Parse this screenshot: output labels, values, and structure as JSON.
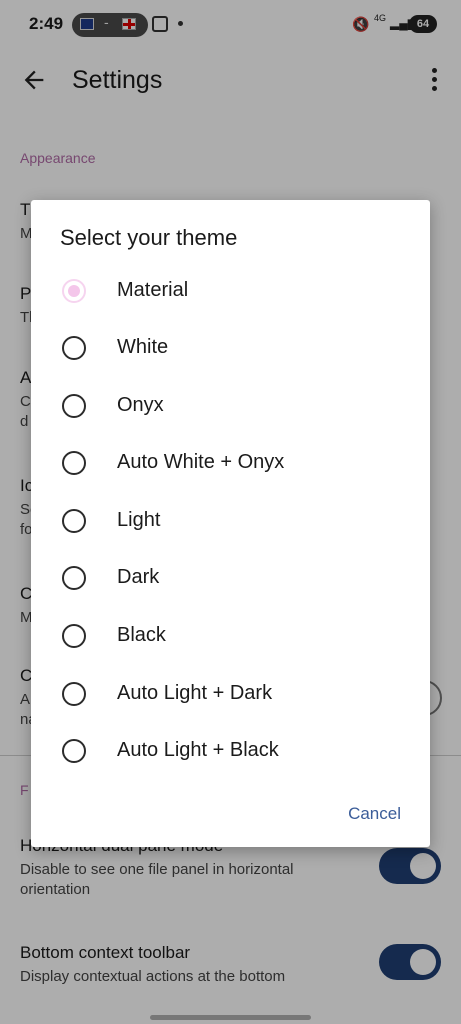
{
  "status_bar": {
    "time": "2:49",
    "network": "4G",
    "battery": "64"
  },
  "app_bar": {
    "title": "Settings"
  },
  "background": {
    "section_appearance": "Appearance",
    "section_other": "F",
    "partial_rows": [
      {
        "title": "T",
        "subtitle": "M"
      },
      {
        "title": "P",
        "subtitle": "Tl"
      },
      {
        "title": "A",
        "subtitle": "C\nd"
      },
      {
        "title": "Ic",
        "subtitle": "Se\nfo"
      },
      {
        "title": "C",
        "subtitle": "M"
      },
      {
        "title": "C",
        "subtitle": "A\nna"
      }
    ],
    "dual_pane": {
      "title": "Horizontal dual pane mode",
      "subtitle": "Disable to see one file panel in horizontal orientation"
    },
    "bottom_toolbar": {
      "title": "Bottom context toolbar",
      "subtitle": "Display contextual actions at the bottom"
    }
  },
  "dialog": {
    "title": "Select your theme",
    "options": [
      {
        "label": "Material",
        "selected": true
      },
      {
        "label": "White",
        "selected": false
      },
      {
        "label": "Onyx",
        "selected": false
      },
      {
        "label": "Auto White + Onyx",
        "selected": false
      },
      {
        "label": "Light",
        "selected": false
      },
      {
        "label": "Dark",
        "selected": false
      },
      {
        "label": "Black",
        "selected": false
      },
      {
        "label": "Auto Light + Dark",
        "selected": false
      },
      {
        "label": "Auto Light + Black",
        "selected": false
      }
    ],
    "cancel_label": "Cancel"
  },
  "colors": {
    "accent": "#3b5d99",
    "toggle_on": "#1f3f73",
    "selected_radio": "#f4c6ea"
  }
}
